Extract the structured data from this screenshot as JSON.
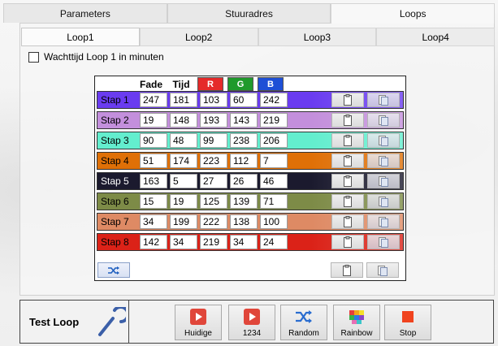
{
  "top_tabs": [
    "Parameters",
    "Stuuradres",
    "Loops"
  ],
  "sub_tabs": [
    "Loop1",
    "Loop2",
    "Loop3",
    "Loop4"
  ],
  "wait_label": "Wachttijd Loop 1 in minuten",
  "headers": {
    "fade": "Fade",
    "tijd": "Tijd",
    "r": "R",
    "g": "G",
    "b": "B"
  },
  "header_colors": {
    "r": "#e52a2a",
    "g": "#1f9a2b",
    "b": "#1e4fd6"
  },
  "steps": [
    {
      "label": "Stap 1",
      "fade": "247",
      "tijd": "181",
      "r": "103",
      "g": "60",
      "b": "242",
      "color": "#6a3cf0",
      "text": "#000"
    },
    {
      "label": "Stap 2",
      "fade": "19",
      "tijd": "148",
      "r": "193",
      "g": "143",
      "b": "219",
      "color": "#c38fdc",
      "text": "#000"
    },
    {
      "label": "Stap 3",
      "fade": "90",
      "tijd": "48",
      "r": "99",
      "g": "238",
      "b": "206",
      "color": "#63eece",
      "text": "#000"
    },
    {
      "label": "Stap 4",
      "fade": "51",
      "tijd": "174",
      "r": "223",
      "g": "112",
      "b": "7",
      "color": "#df7007",
      "text": "#000"
    },
    {
      "label": "Stap 5",
      "fade": "163",
      "tijd": "5",
      "r": "27",
      "g": "26",
      "b": "46",
      "color": "#1b1a2e",
      "text": "#fff"
    },
    {
      "label": "Stap 6",
      "fade": "15",
      "tijd": "19",
      "r": "125",
      "g": "139",
      "b": "71",
      "color": "#7d8b47",
      "text": "#000"
    },
    {
      "label": "Stap 7",
      "fade": "34",
      "tijd": "199",
      "r": "222",
      "g": "138",
      "b": "100",
      "color": "#de8a64",
      "text": "#000"
    },
    {
      "label": "Stap 8",
      "fade": "142",
      "tijd": "34",
      "r": "219",
      "g": "34",
      "b": "24",
      "color": "#db2218",
      "text": "#000"
    }
  ],
  "test_loop": {
    "title": "Test Loop",
    "buttons": [
      "Huidige",
      "1234",
      "Random",
      "Rainbow",
      "Stop"
    ]
  }
}
